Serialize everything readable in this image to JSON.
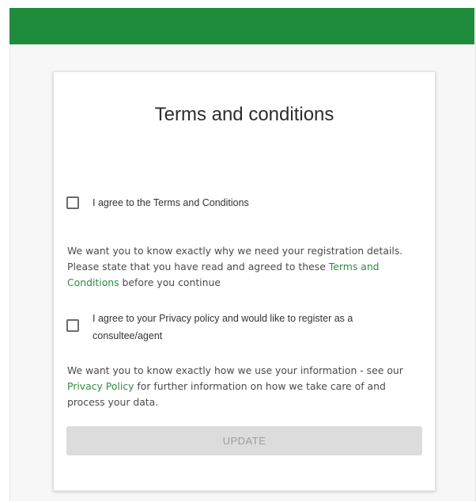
{
  "card": {
    "title": "Terms and conditions",
    "terms_checkbox_label": "I agree to the Terms and Conditions",
    "terms_info": {
      "before": "We want you to know exactly why we need your registration details. Please state that you have read and agreed to these",
      "link": "Terms and Conditions",
      "after": "before you continue"
    },
    "privacy_checkbox_label": "I agree to your Privacy policy and would like to register as a consultee/agent",
    "privacy_info": {
      "before": "We want you to know exactly how we use your information - see our",
      "link": "Privacy Policy",
      "after": "for further information on how we take care of and process your data."
    },
    "update_label": "UPDATE"
  },
  "colors": {
    "header_green": "#1f8b3d",
    "link_green": "#2e8b3d",
    "disabled_button": "#dcdcdc"
  }
}
